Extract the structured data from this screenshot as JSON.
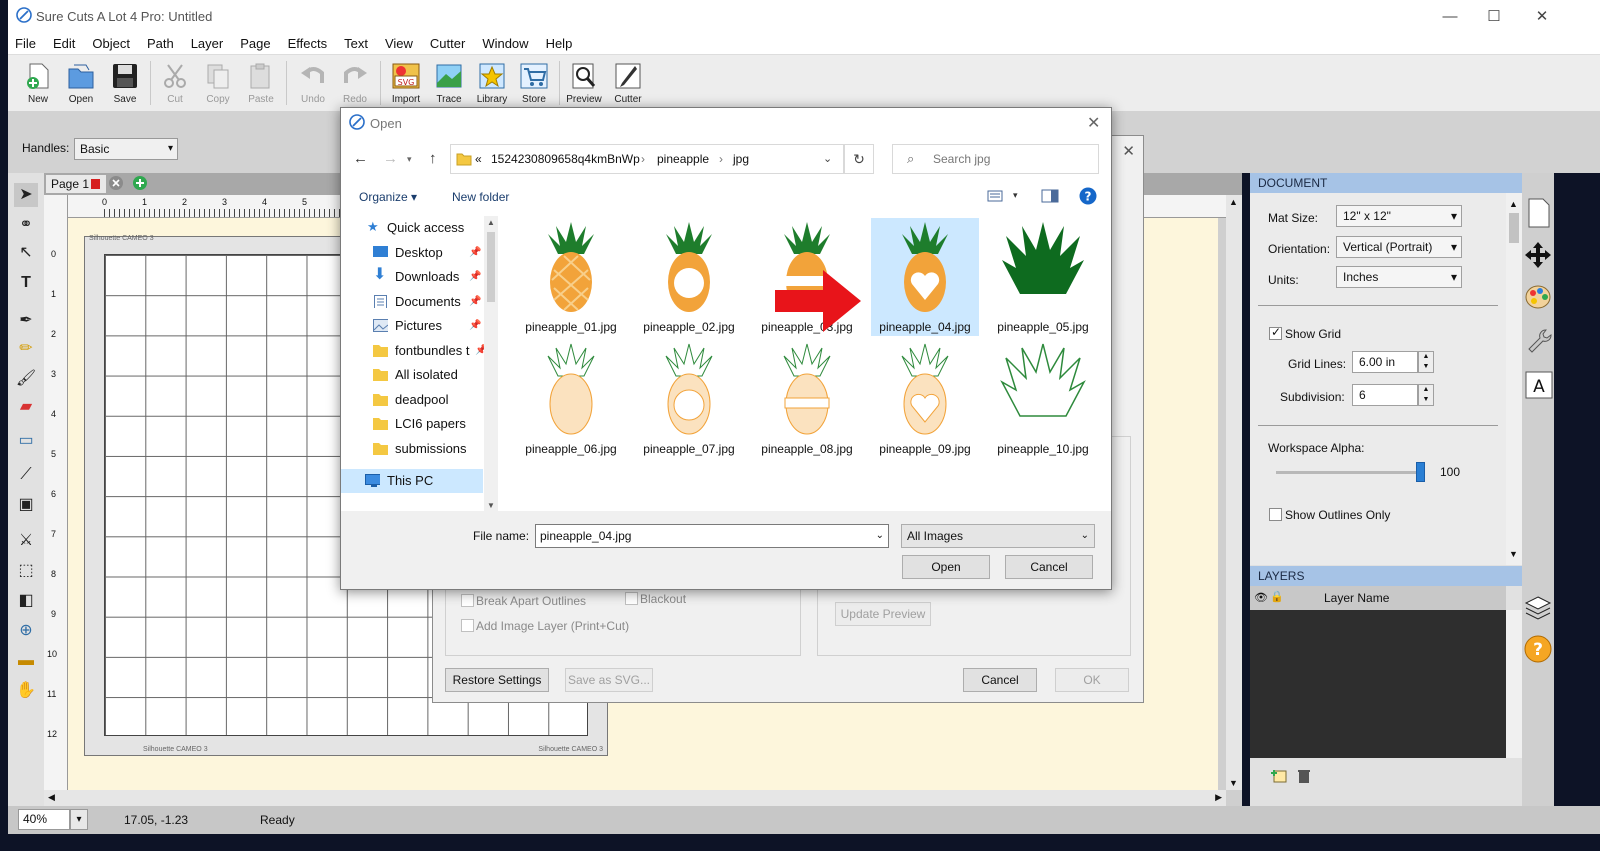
{
  "window": {
    "title": "Sure Cuts A Lot 4 Pro: Untitled",
    "minimize": "—",
    "maximize": "☐",
    "close": "✕"
  },
  "menu": [
    "File",
    "Edit",
    "Object",
    "Path",
    "Layer",
    "Page",
    "Effects",
    "Text",
    "View",
    "Cutter",
    "Window",
    "Help"
  ],
  "toolbar": {
    "new": "New",
    "open": "Open",
    "save": "Save",
    "cut": "Cut",
    "copy": "Copy",
    "paste": "Paste",
    "undo": "Undo",
    "redo": "Redo",
    "import": "Import",
    "trace": "Trace",
    "library": "Library",
    "store": "Store",
    "preview": "Preview",
    "cutter": "Cutter",
    "import_badge": "SVG"
  },
  "handles": {
    "label": "Handles:",
    "value": "Basic"
  },
  "page_tab": {
    "label": "Page 1"
  },
  "ruler": {
    "h_ticks": [
      "0",
      "1",
      "2",
      "3",
      "4",
      "5"
    ],
    "v_ticks": [
      "0",
      "1",
      "2",
      "3",
      "4",
      "5",
      "6",
      "7",
      "8",
      "9",
      "10",
      "11",
      "12"
    ]
  },
  "mat": {
    "label_top": "Silhouette CAMEO 3",
    "label_bottom_left": "Silhouette CAMEO 3",
    "label_bottom_right": "Silhouette CAMEO 3"
  },
  "document_panel": {
    "title": "DOCUMENT",
    "mat_size_label": "Mat Size:",
    "mat_size": "12\" x 12\"",
    "orientation_label": "Orientation:",
    "orientation": "Vertical (Portrait)",
    "units_label": "Units:",
    "units": "Inches",
    "show_grid": "Show Grid",
    "grid_lines_label": "Grid Lines:",
    "grid_lines": "6.00 in",
    "subdivision_label": "Subdivision:",
    "subdivision": "6",
    "alpha_label": "Workspace Alpha:",
    "alpha": "100",
    "outlines": "Show Outlines Only"
  },
  "layers_panel": {
    "title": "LAYERS",
    "col": "Layer Name"
  },
  "status": {
    "zoom": "40%",
    "coords": "17.05, -1.23",
    "state": "Ready"
  },
  "import_dialog": {
    "break_apart": "Break Apart Outlines",
    "blackout": "Blackout",
    "add_image_layer": "Add Image Layer (Print+Cut)",
    "update_preview": "Update Preview",
    "restore": "Restore Settings",
    "save_svg": "Save as SVG...",
    "cancel": "Cancel",
    "ok": "OK"
  },
  "open_dialog": {
    "title": "Open",
    "path": [
      "«",
      "1524230809658q4kmBnWp",
      "pineapple",
      "jpg"
    ],
    "search_placeholder": "Search jpg",
    "organize": "Organize ▾",
    "new_folder": "New folder",
    "nav": [
      "Quick access",
      "Desktop",
      "Downloads",
      "Documents",
      "Pictures",
      "fontbundles t",
      "All isolated",
      "deadpool",
      "LCI6 papers",
      "submissions",
      "This PC"
    ],
    "files": [
      "pineapple_01.jpg",
      "pineapple_02.jpg",
      "pineapple_03.jpg",
      "pineapple_04.jpg",
      "pineapple_05.jpg",
      "pineapple_06.jpg",
      "pineapple_07.jpg",
      "pineapple_08.jpg",
      "pineapple_09.jpg",
      "pineapple_10.jpg"
    ],
    "selected_file": "pineapple_04.jpg",
    "filename_label": "File name:",
    "filename": "pineapple_04.jpg",
    "filter": "All Images",
    "open": "Open",
    "cancel": "Cancel"
  },
  "colors": {
    "accent_blue": "#a6c3e6",
    "selection": "#cce8ff",
    "pineapple_leaf": "#1e7d2c",
    "pineapple_fruit": "#f2a33a",
    "arrow": "#e8141a"
  }
}
